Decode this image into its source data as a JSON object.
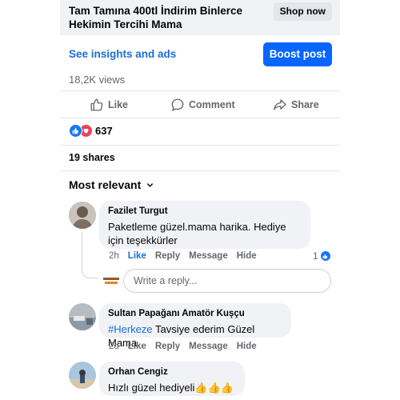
{
  "ad": {
    "title": "Tam Tamına 400tl İndirim Binlerce Hekimin Tercihi Mama",
    "cta": "Shop now"
  },
  "insights": {
    "link": "See insights and ads",
    "boost": "Boost post",
    "views": "18,2K views"
  },
  "actions": [
    {
      "label": "Like",
      "icon": "thumbs-up-icon"
    },
    {
      "label": "Comment",
      "icon": "comment-bubble-icon"
    },
    {
      "label": "Share",
      "icon": "share-arrow-icon"
    }
  ],
  "reactions": {
    "count": "637",
    "types": [
      "like",
      "love"
    ]
  },
  "shares": "19 shares",
  "sort": {
    "label": "Most relevant",
    "icon": "chevron-down-icon"
  },
  "comments": [
    {
      "name": "Fazilet Turgut",
      "text": "Paketleme güzel.mama harika. Hediye için teşekkürler",
      "time": "2h",
      "like": "Like",
      "reply": "Reply",
      "message": "Message",
      "hide": "Hide",
      "like_count": "1",
      "liked": true
    },
    {
      "name": "Sultan Papağanı Amatör Kuşçu",
      "hashtag": "#Herkeze",
      "text": " Tavsiye ederim Güzel Mama",
      "time": "2d",
      "like": "Like",
      "reply": "Reply",
      "message": "Message",
      "hide": "Hide"
    },
    {
      "name": "Orhan Cengiz",
      "text": "Hızlı güzel hediyeli👍👍👍"
    }
  ],
  "reply_box": {
    "placeholder": "Write a reply..."
  },
  "colors": {
    "accent": "#0866ff",
    "link": "#1a6ed8",
    "muted": "#65676b",
    "bubble": "#f0f2f5"
  }
}
